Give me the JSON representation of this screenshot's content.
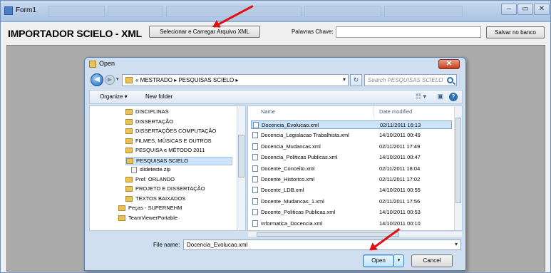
{
  "window": {
    "title": "Form1",
    "controls": [
      "–",
      "▭",
      "✕"
    ]
  },
  "toolbar": {
    "app_title": "IMPORTADOR SCIELO - XML",
    "select_button": "Selecionar e Carregar Arquivo XML",
    "keywords_label": "Palavras Chave:",
    "keywords_value": "",
    "save_button": "Salvar no banco"
  },
  "dialog": {
    "title": "Open",
    "close_label": "✕",
    "address_path": "« MESTRADO ▸ PESQUISAS SCIELO ▸",
    "search_placeholder": "Search PESQUISAS SCIELO",
    "commands": {
      "organize": "Organize ▾",
      "new_folder": "New folder"
    },
    "nav_tree": [
      {
        "label": "DISCIPLINAS",
        "type": "folder",
        "selected": false
      },
      {
        "label": "DISSERTAÇÃO",
        "type": "folder",
        "selected": false
      },
      {
        "label": "DISSERTAÇÕES COMPUTAÇÃO",
        "type": "folder",
        "selected": false
      },
      {
        "label": "FILMES, MÚSICAS E OUTROS",
        "type": "folder",
        "selected": false
      },
      {
        "label": "PESQUISA e MÉTODO 2011",
        "type": "folder",
        "selected": false
      },
      {
        "label": "PESQUISAS SCIELO",
        "type": "folder",
        "selected": true
      },
      {
        "label": "slideteste.zip",
        "type": "file",
        "selected": false
      },
      {
        "label": "Prof. ORLANDO",
        "type": "folder",
        "selected": false
      },
      {
        "label": "PROJETO E DISSERTAÇÃO",
        "type": "folder",
        "selected": false
      },
      {
        "label": "TEXTOS BAIXADOS",
        "type": "folder",
        "selected": false
      },
      {
        "label": "Peças - SUPERNEHM",
        "type": "folder",
        "selected": false
      },
      {
        "label": "TeamViewerPortable",
        "type": "folder",
        "selected": false
      }
    ],
    "columns": {
      "name": "Name",
      "date": "Date modified"
    },
    "files": [
      {
        "name": "Docencia_Evolucao.xml",
        "date": "02/11/2011 16:13",
        "selected": true
      },
      {
        "name": "Docencia_Legislacao Trabalhista.xml",
        "date": "14/10/2011 00:49",
        "selected": false
      },
      {
        "name": "Docencia_Mudancas.xml",
        "date": "02/11/2011 17:49",
        "selected": false
      },
      {
        "name": "Docencia_Politicas Publicas.xml",
        "date": "14/10/2011 00:47",
        "selected": false
      },
      {
        "name": "Docente_Conceito.xml",
        "date": "02/11/2011 18:04",
        "selected": false
      },
      {
        "name": "Docente_Historico.xml",
        "date": "02/11/2011 17:02",
        "selected": false
      },
      {
        "name": "Docente_LDB.xml",
        "date": "14/10/2011 00:55",
        "selected": false
      },
      {
        "name": "Docente_Mudancas_1.xml",
        "date": "02/11/2011 17:56",
        "selected": false
      },
      {
        "name": "Docente_Politicas Publicas.xml",
        "date": "14/10/2011 00:53",
        "selected": false
      },
      {
        "name": "Informatica_Docencia.xml",
        "date": "14/10/2011 00:10",
        "selected": false
      }
    ],
    "file_name_label": "File name:",
    "file_name_value": "Docencia_Evolucao.xml",
    "open_button": "Open",
    "cancel_button": "Cancel"
  },
  "colors": {
    "annotation_arrow": "#e01010",
    "selection": "#cde3f8"
  }
}
